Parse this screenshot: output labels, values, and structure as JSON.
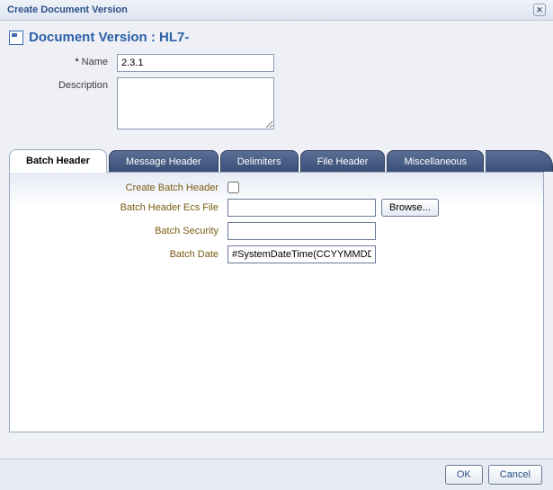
{
  "dialog": {
    "title": "Create Document Version"
  },
  "header": {
    "title": "Document Version : HL7-"
  },
  "form": {
    "name_label": "Name",
    "name_value": "2.3.1",
    "description_label": "Description",
    "description_value": ""
  },
  "tabs": {
    "items": [
      {
        "label": "Batch Header",
        "active": true
      },
      {
        "label": "Message Header",
        "active": false
      },
      {
        "label": "Delimiters",
        "active": false
      },
      {
        "label": "File Header",
        "active": false
      },
      {
        "label": "Miscellaneous",
        "active": false
      }
    ]
  },
  "batch_header": {
    "create_label": "Create Batch Header",
    "create_checked": false,
    "ecs_label": "Batch Header Ecs File",
    "ecs_value": "",
    "browse_label": "Browse...",
    "security_label": "Batch Security",
    "security_value": "",
    "date_label": "Batch Date",
    "date_value": "#SystemDateTime(CCYYMMDDHHMM)#"
  },
  "footer": {
    "ok_label": "OK",
    "cancel_label": "Cancel"
  }
}
